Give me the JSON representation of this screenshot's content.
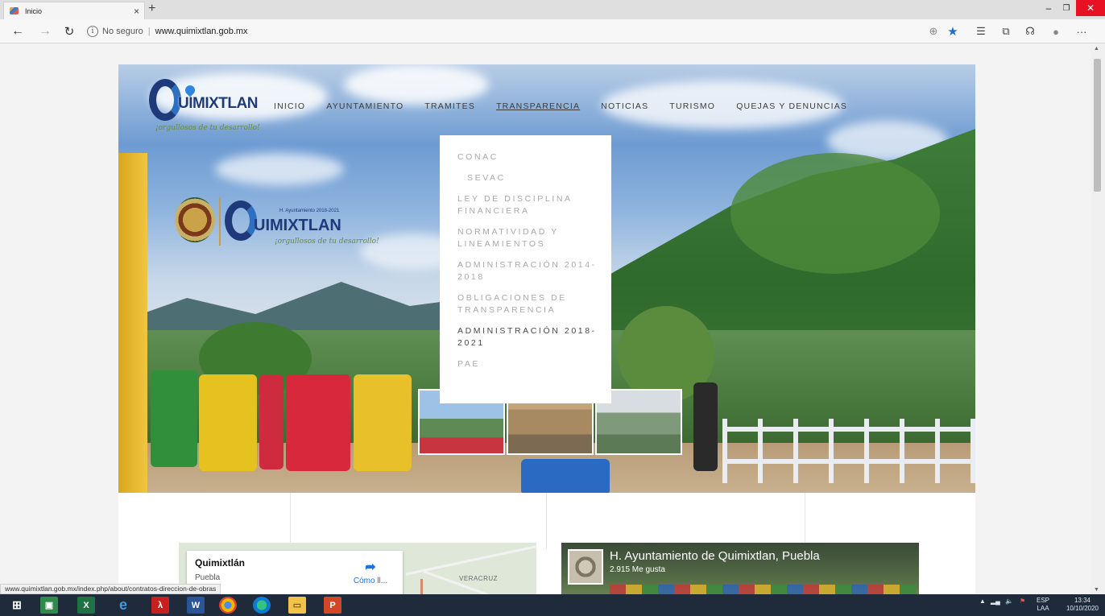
{
  "browser": {
    "tab_title": "Inicio",
    "tab_close": "×",
    "new_tab": "+",
    "security_label": "No seguro",
    "url": "www.quimixtlan.gob.mx",
    "status_url": "www.quimixtlan.gob.mx/index.php/about/contratos-direccion-de-obras"
  },
  "site": {
    "logo_text": "UIMIXTLAN",
    "logo_sub": "¡orgullosos de tu desarrollo!",
    "logo2_text": "UIMIXTLAN",
    "logo2_period": "H. Ayuntamiento 2018-2021",
    "logo2_sub": "¡orgullosos de tu desarrollo!",
    "nav": [
      {
        "label": "INICIO"
      },
      {
        "label": "AYUNTAMIENTO"
      },
      {
        "label": "TRAMITES"
      },
      {
        "label": "TRANSPARENCIA"
      },
      {
        "label": "NOTICIAS"
      },
      {
        "label": "TURISMO"
      },
      {
        "label": "QUEJAS Y DENUNCIAS"
      }
    ],
    "dropdown": [
      {
        "label": "CONAC"
      },
      {
        "label": "SEVAC"
      },
      {
        "label": "LEY DE DISCIPLINA FINANCIERA"
      },
      {
        "label": "NORMATIVIDAD Y LINEAMIENTOS"
      },
      {
        "label": "ADMINISTRACIÓN 2014-2018"
      },
      {
        "label": "OBLIGACIONES DE TRANSPARENCIA"
      },
      {
        "label": "ADMINISTRACIÓN 2018-2021"
      },
      {
        "label": "PAE"
      }
    ]
  },
  "map": {
    "title": "Quimixtlán",
    "subtitle": "Puebla",
    "directions_label": "Cómo ll...",
    "state_label": "VERACRUZ"
  },
  "facebook": {
    "page_name": "H. Ayuntamiento de Quimixtlan, Puebla",
    "likes": "2.915 Me gusta"
  },
  "taskbar": {
    "lang": "ESP",
    "lang_sub": "LAA",
    "time": "13:34",
    "date": "10/10/2020"
  }
}
